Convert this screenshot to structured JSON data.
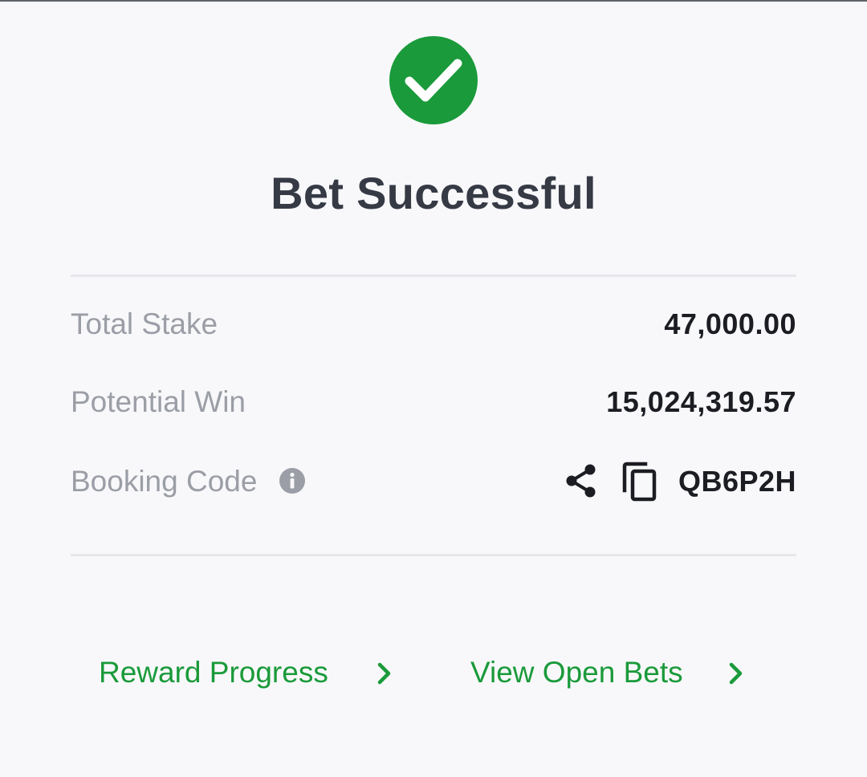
{
  "title": "Bet Successful",
  "summary": {
    "total_stake_label": "Total Stake",
    "total_stake_value": "47,000.00",
    "potential_win_label": "Potential Win",
    "potential_win_value": "15,024,319.57",
    "booking_code_label": "Booking Code",
    "booking_code_value": "QB6P2H"
  },
  "links": {
    "reward_progress": "Reward Progress",
    "view_open_bets": "View Open Bets"
  },
  "icons": {
    "success": "check-circle-icon",
    "info": "info-icon",
    "share": "share-icon",
    "copy": "copy-icon",
    "chevron": "chevron-right-icon"
  },
  "colors": {
    "success_green": "#1a9a3a",
    "title_text": "#353a45",
    "label_text": "#9b9ea6",
    "value_text": "#1b1d22",
    "background": "#f8f8fa"
  }
}
